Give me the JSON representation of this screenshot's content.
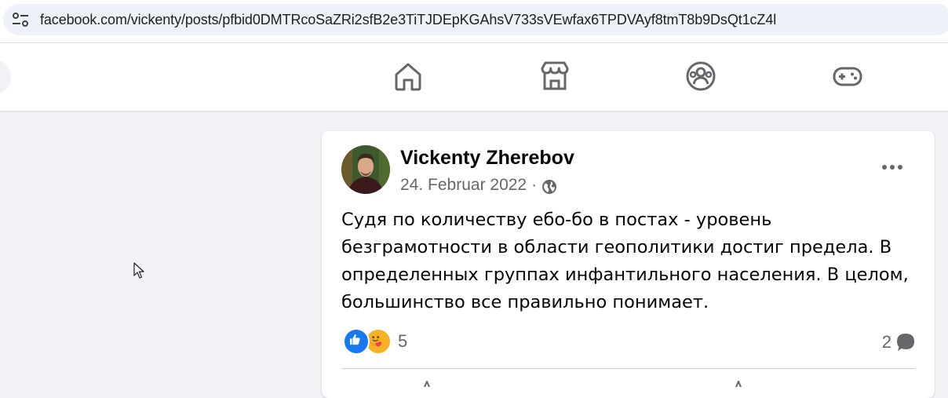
{
  "browser": {
    "url": "facebook.com/vickenty/posts/pfbid0DMTRcoSaZRi2sfB2e3TiTJDEpKGAhsV733sVEwfax6TPDVAyf8tmT8b9DsQt1cZ4l",
    "site_info_icon": "tune-icon"
  },
  "nav": {
    "tabs": [
      {
        "name": "home",
        "icon": "home-icon"
      },
      {
        "name": "marketplace",
        "icon": "marketplace-icon"
      },
      {
        "name": "groups",
        "icon": "groups-icon"
      },
      {
        "name": "gaming",
        "icon": "gaming-icon"
      }
    ],
    "icon_color": "#65676b"
  },
  "post": {
    "author": "Vickenty Zherebov",
    "date": "24. Februar 2022",
    "separator": "·",
    "privacy_icon": "globe-icon",
    "text_lines": [
      "Судя по количеству ебо-бо в постах - уровень",
      "безграмотности в области геополитики достиг предела. В",
      "определенных группах инфантильного населения. В целом,",
      "большинство все правильно понимает."
    ],
    "reactions": {
      "types": [
        "like",
        "care"
      ],
      "count": "5"
    },
    "comments": {
      "count": "2"
    },
    "colors": {
      "like": "#1877f2",
      "care": "#f7b125",
      "secondary_text": "#65676b"
    }
  }
}
